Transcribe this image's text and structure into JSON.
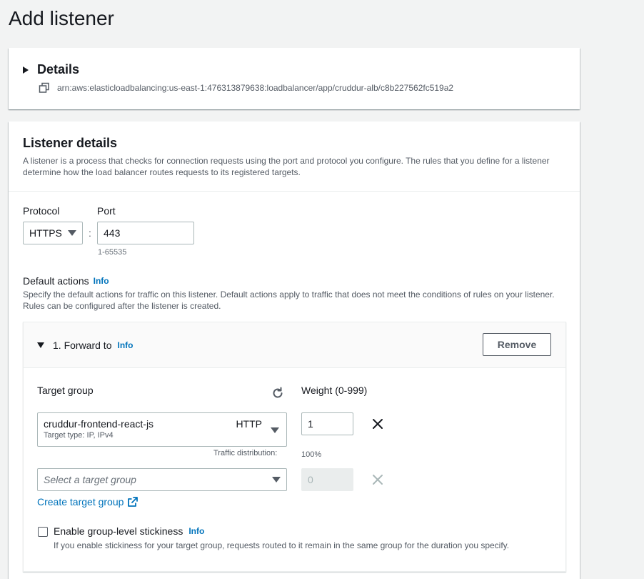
{
  "page": {
    "title": "Add listener"
  },
  "details": {
    "title": "Details",
    "arn": "arn:aws:elasticloadbalancing:us-east-1:476313879638:loadbalancer/app/cruddur-alb/c8b227562fc519a2"
  },
  "listener": {
    "title": "Listener details",
    "description": "A listener is a process that checks for connection requests using the port and protocol you configure. The rules that you define for a listener determine how the load balancer routes requests to its registered targets.",
    "protocol_label": "Protocol",
    "protocol_value": "HTTPS",
    "separator": ":",
    "port_label": "Port",
    "port_value": "443",
    "port_hint": "1-65535",
    "default_actions_label": "Default actions",
    "info": "Info",
    "default_actions_desc": "Specify the default actions for traffic on this listener. Default actions apply to traffic that does not meet the conditions of rules on your listener. Rules can be configured after the listener is created."
  },
  "forward": {
    "title": "1. Forward to",
    "info": "Info",
    "remove_label": "Remove",
    "target_group_label": "Target group",
    "weight_label": "Weight (0-999)",
    "row1": {
      "name": "cruddur-frontend-react-js",
      "protocol": "HTTP",
      "sub": "Target type: IP, IPv4",
      "weight": "1"
    },
    "traffic_label": "Traffic distribution:",
    "traffic_value": "100%",
    "row2": {
      "placeholder": "Select a target group",
      "weight": "0"
    },
    "create_link": "Create target group",
    "stickiness_label": "Enable group-level stickiness",
    "stickiness_info": "Info",
    "stickiness_desc": "If you enable stickiness for your target group, requests routed to it remain in the same group for the duration you specify."
  },
  "icons": {
    "copy": "copy-icon",
    "refresh": "refresh-icon",
    "close": "close-icon",
    "external": "external-link-icon"
  },
  "colors": {
    "link": "#0073bb",
    "text": "#16191f",
    "muted": "#545b64",
    "background": "#f2f3f3"
  }
}
